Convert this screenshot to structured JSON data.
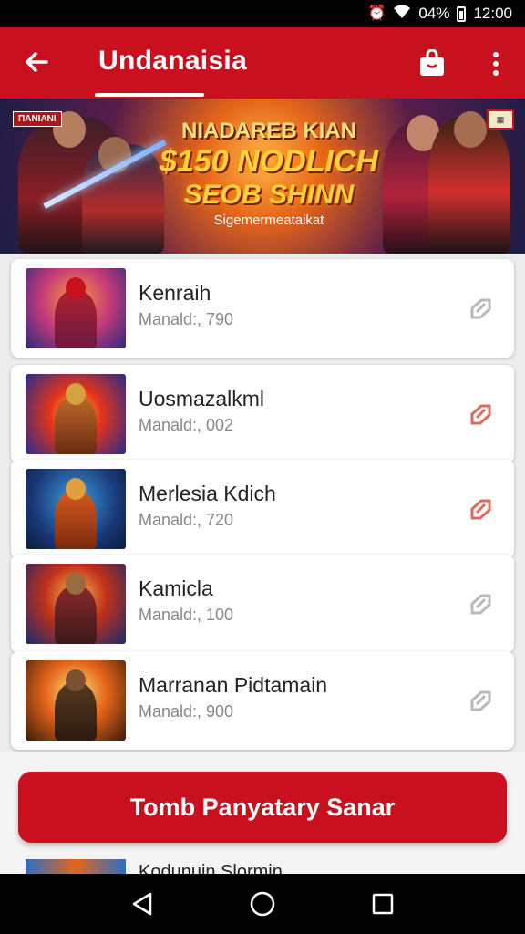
{
  "status_bar": {
    "battery": "04%",
    "time": "12:00",
    "icons": [
      "alarm-icon",
      "wifi-icon",
      "battery-icon"
    ]
  },
  "app_bar": {
    "title": "Undanaisia",
    "icons": [
      "back-arrow-icon",
      "shopping-bag-icon",
      "more-vert-icon"
    ]
  },
  "banner": {
    "badge_left": "ΠΑΝΙΑΝΙ",
    "line1": "NIADAREB KIAN",
    "line2": "$150 NODLICH",
    "line3": "SEOB SHINN",
    "line4": "Sigemermeataikat"
  },
  "items": [
    {
      "name": "Kenraih",
      "meta": "Manald:, 790",
      "action_icon": "tag-icon",
      "action_color": "#b8b8b8"
    },
    {
      "name": "Uosmazalkml",
      "meta": "Manald:, 002",
      "action_icon": "tag-icon",
      "action_color": "#e06a5a"
    },
    {
      "name": "Merlesia Kdich",
      "meta": "Manald:, 720",
      "action_icon": "tag-icon",
      "action_color": "#e06a5a"
    },
    {
      "name": "Kamicla",
      "meta": "Manald:, 100",
      "action_icon": "tag-icon",
      "action_color": "#b8b8b8"
    },
    {
      "name": "Marranan Pidtamain",
      "meta": "Manald:, 900",
      "action_icon": "tag-icon",
      "action_color": "#b8b8b8"
    }
  ],
  "peek_item": {
    "name": "Kodunuin Slormin"
  },
  "cta": {
    "label": "Tomb Panyatary Sanar"
  },
  "colors": {
    "accent": "#c8101e"
  },
  "nav_bar": {
    "icons": [
      "back-triangle-icon",
      "home-circle-icon",
      "recents-square-icon"
    ]
  }
}
